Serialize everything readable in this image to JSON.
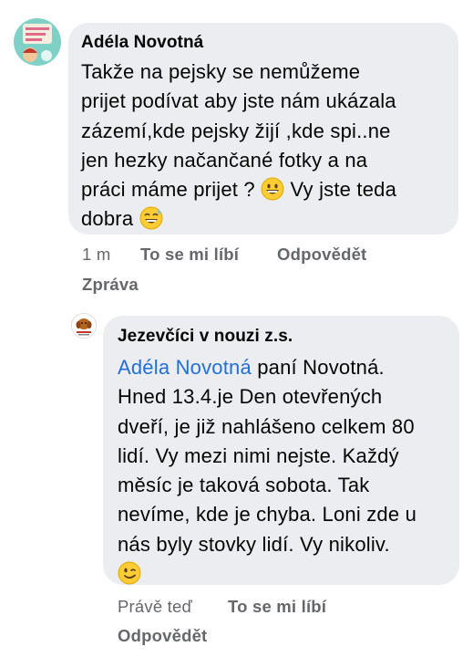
{
  "comments": [
    {
      "author": "Adéla Novotná",
      "lines": [
        "Takže na pejsky se nemůžeme",
        "prijet podívat aby jste nám ukázala",
        "zázemí,kde pejsky žijí ,kde spi..ne",
        "jen hezky načančané fotky a na",
        "práci máme prijet ? ",
        " Vy jste teda",
        "dobra "
      ],
      "emojis": [
        "grinning-face-emoji",
        "grinning-sweat-face-emoji"
      ],
      "time": "1 m",
      "like_label": "To se mi líbí",
      "reply_label": "Odpovědět",
      "message_label": "Zpráva"
    },
    {
      "author": "Jezevčíci v nouzi z.s.",
      "mention": "Adéla Novotná",
      "lines": [
        " paní Novotná.",
        "Hned 13.4.je Den otevřených",
        "dveří, je již nahlášeno celkem 80",
        "lidí. Vy mezi nimi nejste. Každý",
        "měsíc je taková sobota. Tak",
        "nevíme, kde je chyba. Loni zde u",
        "nás byly stovky lidí. Vy nikoliv."
      ],
      "emojis": [
        "winking-face-emoji"
      ],
      "time": "Právě teď",
      "like_label": "To se mi líbí",
      "reply_label": "Odpovědět"
    }
  ],
  "colors": {
    "bubble": "#ebedf0",
    "text": "#050505",
    "meta": "#65676b",
    "mention": "#216fdb"
  }
}
